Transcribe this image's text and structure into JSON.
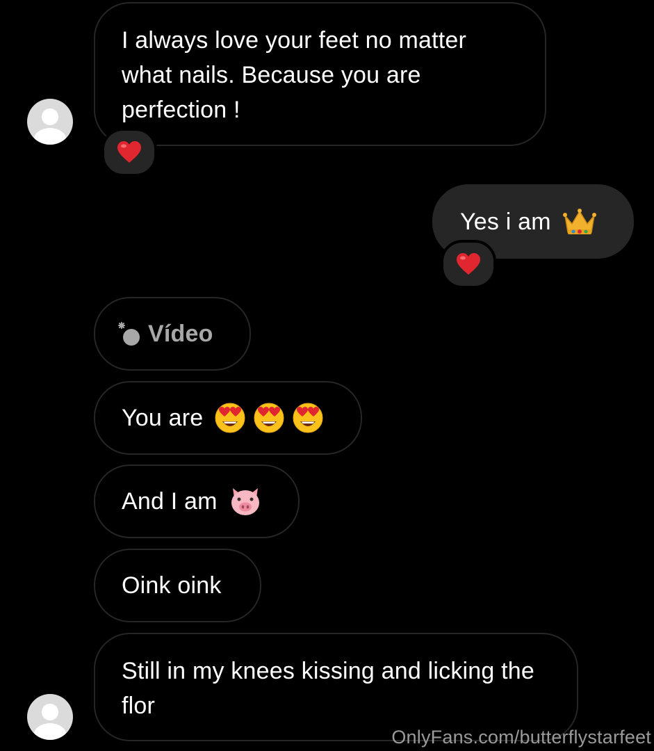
{
  "messages": [
    {
      "text": "I always love your feet no matter what nails. Because you are perfection !",
      "reaction": "heart"
    },
    {
      "text": "Yes i am",
      "emoji": "crown",
      "reaction": "heart"
    },
    {
      "text": "Vídeo",
      "icon": "video-attachment-icon"
    },
    {
      "text": "You are",
      "emojis": [
        "heart-eyes",
        "heart-eyes",
        "heart-eyes"
      ]
    },
    {
      "text": "And I am",
      "emoji": "pig-face"
    },
    {
      "text": "Oink oink"
    },
    {
      "text": "Still in my knees kissing and licking the flor"
    }
  ],
  "watermark": "OnlyFans.com/butterflystarfeet",
  "colors": {
    "background": "#000000",
    "received_border": "#262626",
    "sent_bubble": "#262626",
    "reaction_heart": "#e0262f",
    "avatar": "#dbdbdb",
    "muted_text": "#a8a8a8"
  }
}
